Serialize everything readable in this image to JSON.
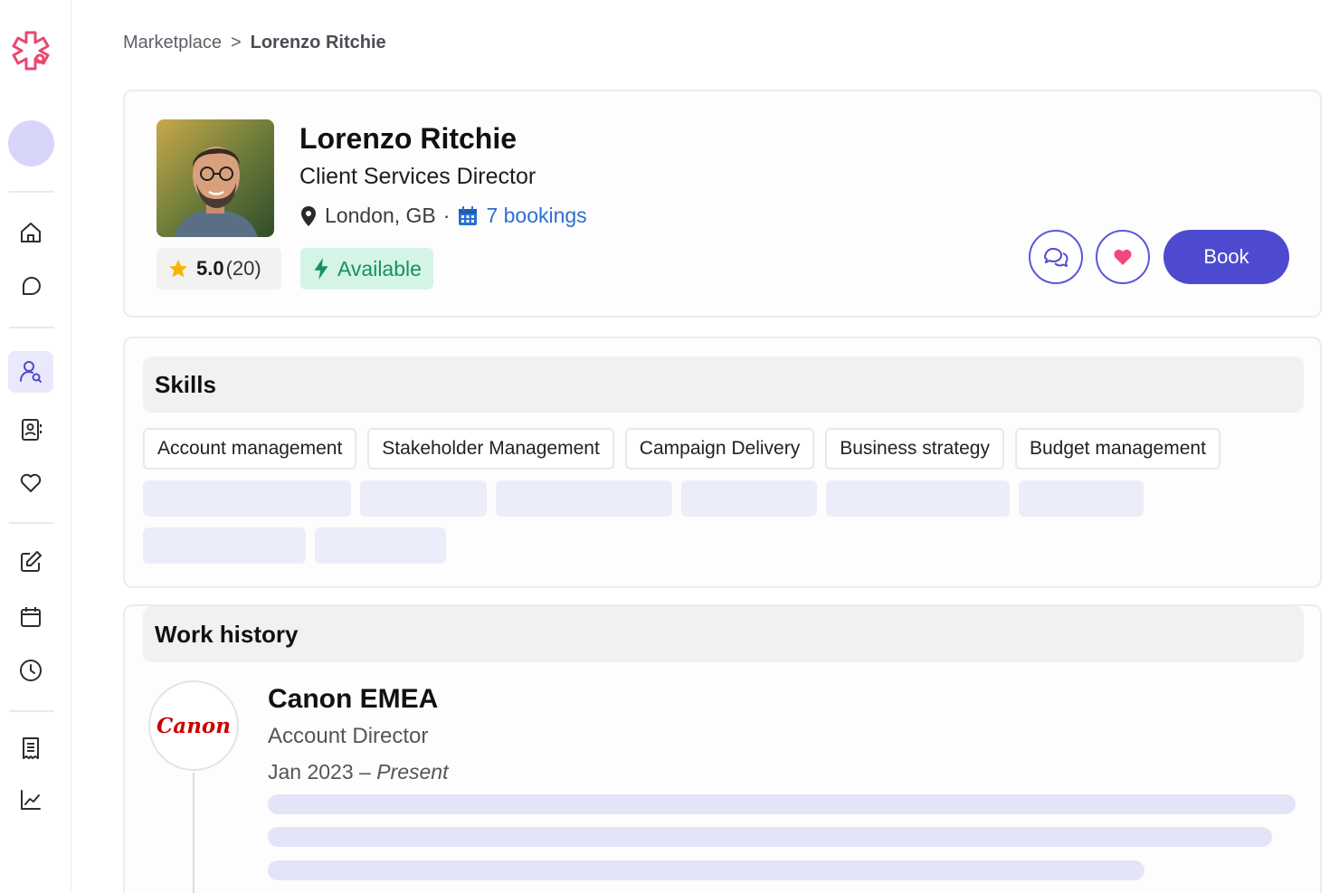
{
  "breadcrumb": {
    "parent": "Marketplace",
    "separator": ">",
    "current": "Lorenzo Ritchie"
  },
  "profile": {
    "name": "Lorenzo Ritchie",
    "title": "Client Services Director",
    "location": "London, GB",
    "dot": "·",
    "bookings": "7 bookings",
    "rating": "5.0",
    "rating_count": "(20)",
    "availability": "Available",
    "book_label": "Book"
  },
  "skills": {
    "heading": "Skills",
    "items": [
      "Account management",
      "Stakeholder Management",
      "Campaign Delivery",
      "Business strategy",
      "Budget management"
    ]
  },
  "work_history": {
    "heading": "Work history",
    "entries": [
      {
        "company": "Canon EMEA",
        "logo_text": "Canon",
        "position": "Account Director",
        "start": "Jan 2023",
        "dash": "–",
        "end": "Present"
      }
    ]
  },
  "colors": {
    "accent": "#4d4acf",
    "available_bg": "#d4f4e6",
    "available_text": "#16925d",
    "link": "#2c6fd1",
    "heart": "#f0497a",
    "logo": "#e8496e"
  },
  "icons": {
    "sidebar": [
      "logo-icon",
      "home-icon",
      "chat-icon",
      "person-search-icon",
      "contact-card-icon",
      "heart-icon",
      "edit-icon",
      "calendar-icon",
      "clock-icon",
      "receipt-icon",
      "chart-icon"
    ]
  }
}
